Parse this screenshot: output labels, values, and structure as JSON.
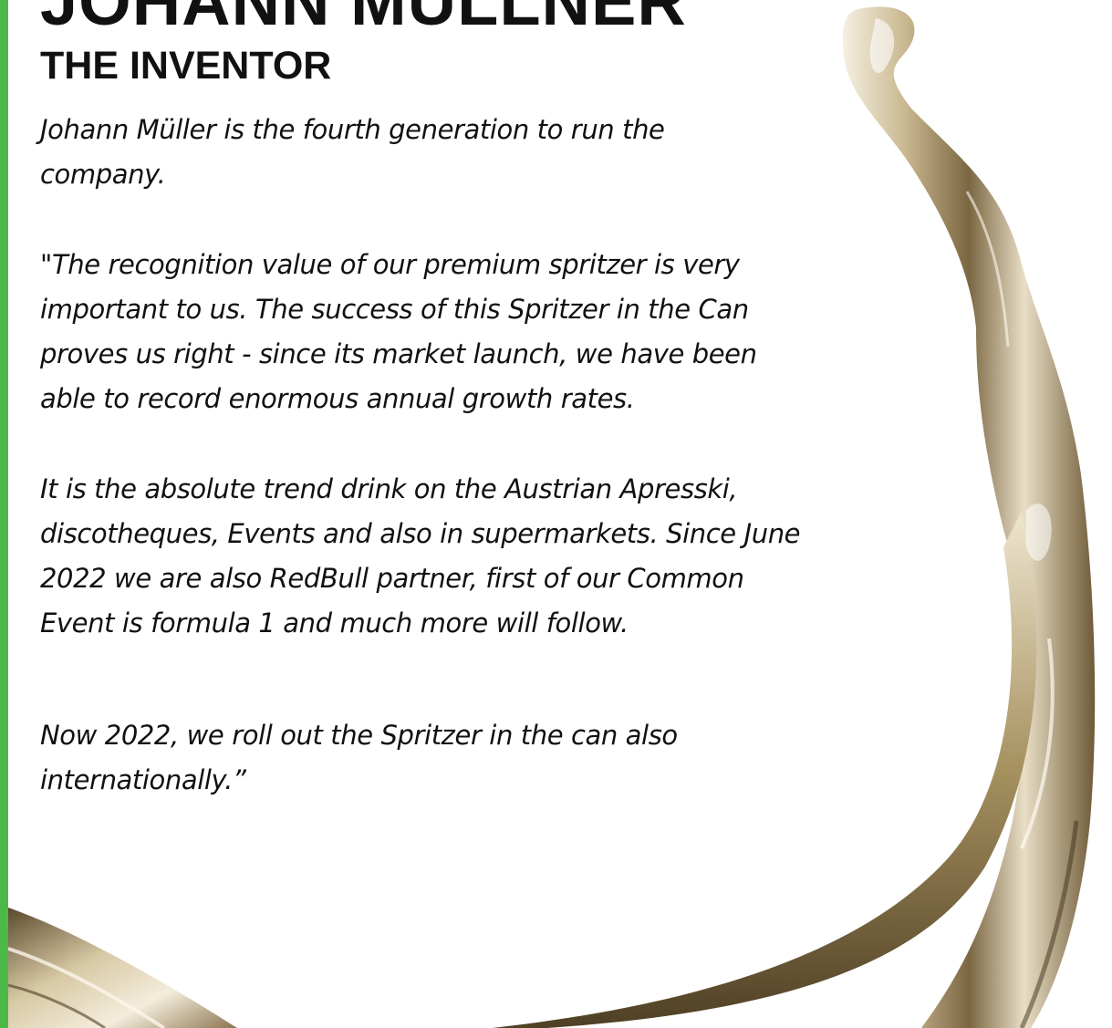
{
  "colors": {
    "accent_bar": "#4cb848",
    "text": "#111111",
    "splash_light": "#f3ecdc",
    "splash_mid": "#c8b68e",
    "splash_dark": "#5e4d30"
  },
  "header": {
    "name": "JOHANN MÜLLNER",
    "subtitle": "THE INVENTOR"
  },
  "paragraphs": [
    "Johann Müller is the fourth generation to run the company.",
    " \"The recognition value of our premium spritzer is very important to us. The  success of this Spritzer in the Can proves us right - since its market launch, we have been able to record enormous annual growth rates.",
    "It is the absolute trend drink on the  Austrian Apresski, discotheques, Events and also in supermarkets. Since June 2022 we are also RedBull partner, first of our Common Event is  formula 1 and much more will follow.",
    "Now 2022, we roll out the Spritzer in the can also internationally.”"
  ],
  "decorations": {
    "background_image": "golden-liquid-splash-image"
  }
}
